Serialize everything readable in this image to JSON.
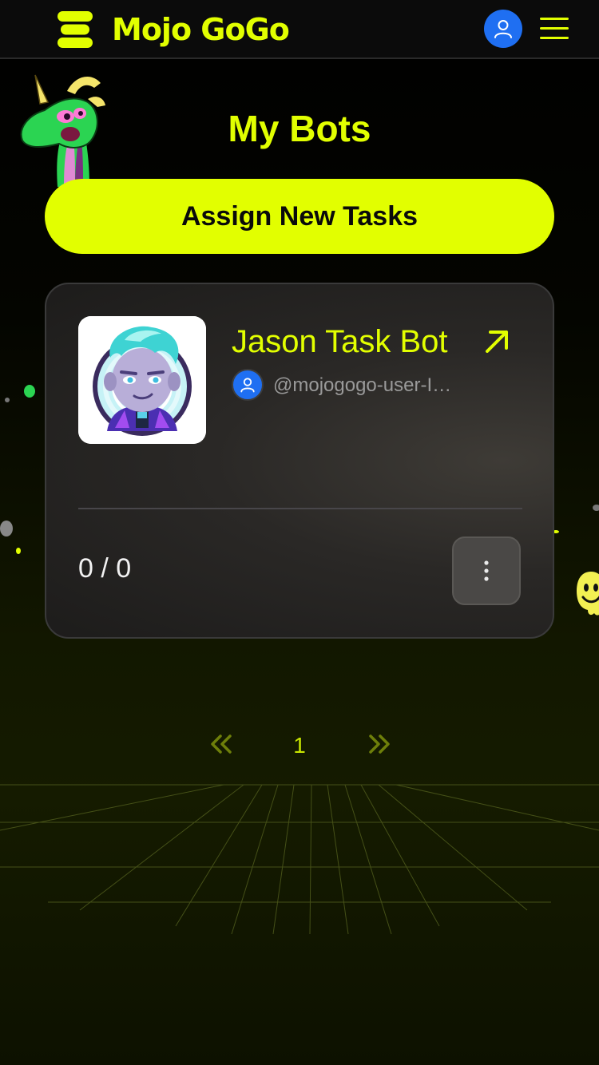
{
  "header": {
    "brand": "Mojo GoGo"
  },
  "page": {
    "title": "My Bots"
  },
  "actions": {
    "assign_label": "Assign New Tasks"
  },
  "bots": [
    {
      "name": "Jason Task Bot",
      "owner_handle": "@mojogogo-user-IG…",
      "task_count": "0 / 0"
    }
  ],
  "pagination": {
    "current_page": "1"
  },
  "colors": {
    "accent": "#e2ff00",
    "avatar_blue": "#1f6ff2",
    "card_bg": "#2a2826"
  }
}
